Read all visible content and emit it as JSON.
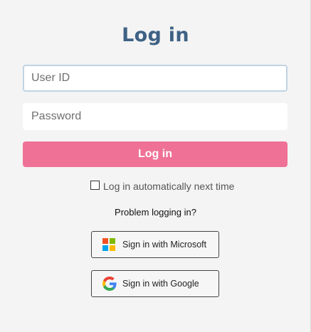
{
  "title": "Log in",
  "user_id": {
    "placeholder": "User ID",
    "value": ""
  },
  "password": {
    "placeholder": "Password",
    "value": ""
  },
  "login_button": "Log in",
  "remember": {
    "label": "Log in automatically next time",
    "checked": false
  },
  "problem_link": "Problem logging in?",
  "sso": {
    "microsoft": {
      "label": "Sign in with Microsoft",
      "icon": "microsoft-logo-icon"
    },
    "google": {
      "label": "Sign in with Google",
      "icon": "google-logo-icon"
    }
  },
  "colors": {
    "background": "#f4f4f4",
    "title": "#3e6285",
    "login_button": "#ef7196",
    "focus_border": "#c0d3e2",
    "ms_red": "#f25022",
    "ms_green": "#7fba00",
    "ms_blue": "#00a4ef",
    "ms_yellow": "#ffb900"
  }
}
